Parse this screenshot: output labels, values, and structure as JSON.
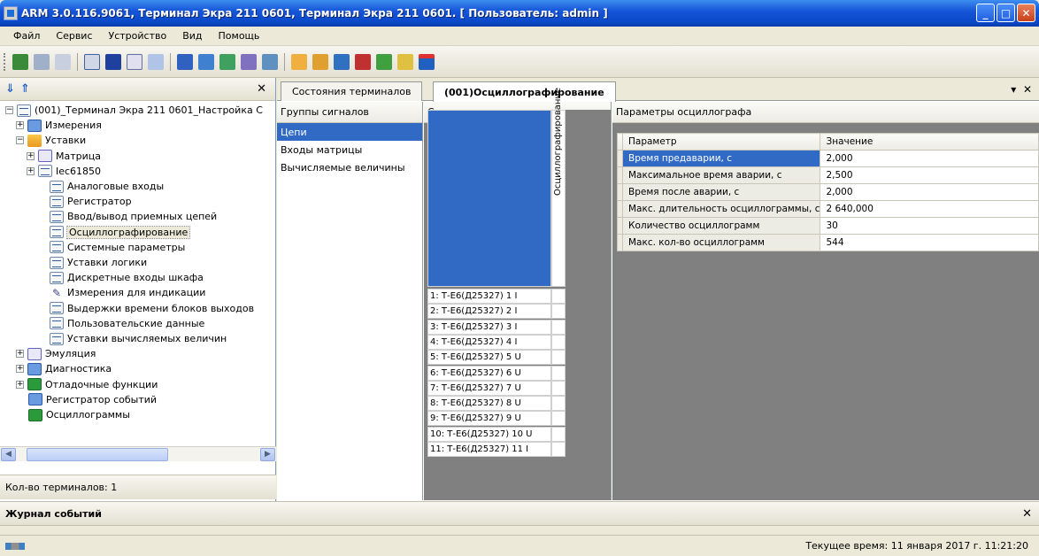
{
  "window": {
    "title": "ARM 3.0.116.9061, Терминал Экра 211 0601, Терминал Экра 211 0601. [ Пользователь: admin ]"
  },
  "menu": [
    "Файл",
    "Сервис",
    "Устройство",
    "Вид",
    "Помощь"
  ],
  "left_panel": {
    "tree": [
      {
        "label": "(001)_Терминал Экра 211 0601_Настройка С",
        "icon": "device-icon",
        "expander": "−",
        "level": 0
      },
      {
        "label": "Измерения",
        "icon": "measurements-icon",
        "expander": "+",
        "level": 1
      },
      {
        "label": "Уставки",
        "icon": "folder-icon",
        "expander": "−",
        "level": 1
      },
      {
        "label": "Матрица",
        "icon": "matrix-icon",
        "expander": "+",
        "level": 2
      },
      {
        "label": "Iec61850",
        "icon": "iec-icon",
        "expander": "+",
        "level": 2
      },
      {
        "label": "Аналоговые входы",
        "icon": "table-icon",
        "level": 3
      },
      {
        "label": "Регистратор",
        "icon": "table-icon",
        "level": 3
      },
      {
        "label": "Ввод/вывод приемных цепей",
        "icon": "table-icon",
        "level": 3
      },
      {
        "label": "Осциллографирование",
        "icon": "table-icon",
        "level": 3,
        "selected": true
      },
      {
        "label": "Системные параметры",
        "icon": "table-icon",
        "level": 3
      },
      {
        "label": "Уставки логики",
        "icon": "table-icon",
        "level": 3
      },
      {
        "label": "Дискретные входы шкафа",
        "icon": "table-icon",
        "level": 3
      },
      {
        "label": "Измерения для индикации",
        "icon": "pen-icon",
        "level": 3
      },
      {
        "label": "Выдержки времени блоков выходов",
        "icon": "table-icon",
        "level": 3
      },
      {
        "label": "Пользовательские данные",
        "icon": "table-icon",
        "level": 3
      },
      {
        "label": "Уставки вычисляемых величин",
        "icon": "table-icon",
        "level": 3
      },
      {
        "label": "Эмуляция",
        "icon": "emulation-icon",
        "expander": "+",
        "level": 1
      },
      {
        "label": "Диагностика",
        "icon": "diagnostics-icon",
        "expander": "+",
        "level": 1
      },
      {
        "label": "Отладочные функции",
        "icon": "debug-icon",
        "expander": "+",
        "level": 1
      },
      {
        "label": "Регистратор событий",
        "icon": "event-recorder-icon",
        "level": 1
      },
      {
        "label": "Осциллограммы",
        "icon": "oscillograms-icon",
        "level": 1
      }
    ],
    "status": "Кол-во терминалов: 1"
  },
  "tabs": [
    {
      "label": "Состояния терминалов",
      "active": false
    },
    {
      "label": "(001)Осциллографирование",
      "active": true
    }
  ],
  "signal_groups": {
    "header": "Группы сигналов",
    "items": [
      {
        "label": "Цепи",
        "selected": true
      },
      {
        "label": "Входы матрицы",
        "selected": false
      },
      {
        "label": "Вычисляемые величины",
        "selected": false
      }
    ]
  },
  "signals": {
    "header": "Сигналы",
    "column_label": "Осциллографирование",
    "rows": [
      "1: Т-Е6(Д25327) 1 I",
      "2: Т-Е6(Д25327) 2 I",
      "3: Т-Е6(Д25327) 3 I",
      "4: Т-Е6(Д25327) 4 I",
      "5: Т-Е6(Д25327) 5 U",
      "6: Т-Е6(Д25327) 6 U",
      "7: Т-Е6(Д25327) 7 U",
      "8: Т-Е6(Д25327) 8 U",
      "9: Т-Е6(Д25327) 9 U",
      "10: Т-Е6(Д25327) 10 U",
      "11: Т-Е6(Д25327) 11 I"
    ]
  },
  "params": {
    "header": "Параметры осциллографа",
    "col_param": "Параметр",
    "col_value": "Значение",
    "rows": [
      {
        "name": "Время предаварии, с",
        "value": "2,000",
        "selected": true
      },
      {
        "name": "Максимальное время аварии, с",
        "value": "2,500"
      },
      {
        "name": "Время после аварии, с",
        "value": "2,000"
      },
      {
        "name": "Макс. длительность осциллограммы, с",
        "value": "2 640,000"
      },
      {
        "name": "Количество осциллограмм",
        "value": "30"
      },
      {
        "name": "Макс. кол-во осциллограмм",
        "value": "544"
      }
    ]
  },
  "journal": {
    "title": "Журнал событий"
  },
  "status": {
    "time": "Текущее время: 11 января 2017 г. 11:21:20"
  },
  "colors": {
    "accent": "#316ac5",
    "titlebar": "#0a48c8",
    "signal_area": "#808080"
  }
}
